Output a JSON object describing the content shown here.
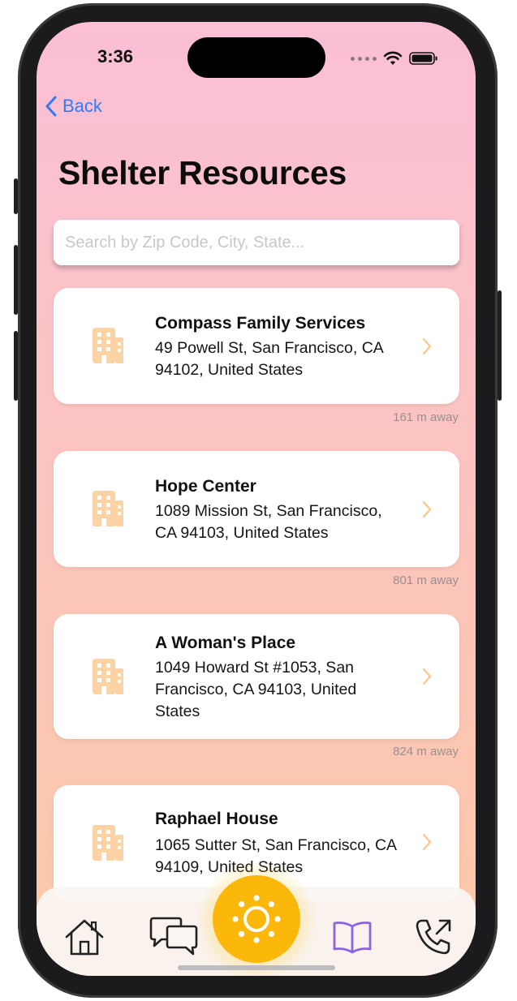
{
  "status_bar": {
    "time": "3:36"
  },
  "nav": {
    "back_label": "Back"
  },
  "page": {
    "title": "Shelter Resources"
  },
  "search": {
    "placeholder": "Search by Zip Code, City, State...",
    "value": ""
  },
  "shelters": [
    {
      "name": "Compass Family Services",
      "address": "49 Powell St, San Francisco, CA 94102, United States",
      "distance": "161 m away"
    },
    {
      "name": "Hope Center",
      "address": "1089 Mission St, San Francisco, CA 94103, United States",
      "distance": "801 m away"
    },
    {
      "name": "A Woman's Place",
      "address": "1049 Howard St #1053, San Francisco, CA 94103, United States",
      "distance": "824 m away"
    },
    {
      "name": "Raphael House",
      "address": "1065 Sutter St, San Francisco, CA 94109, United States",
      "distance": ""
    }
  ],
  "tabs": [
    {
      "icon": "home-icon"
    },
    {
      "icon": "chat-bubbles-icon"
    },
    {
      "icon": "sun-icon"
    },
    {
      "icon": "book-icon"
    },
    {
      "icon": "phone-outgoing-icon"
    }
  ],
  "colors": {
    "accent_blue": "#2f7cf6",
    "building_icon": "#fbd3a4",
    "chevron": "#fbc88e",
    "fab": "#fbb70a",
    "active_tab": "#8a63e6",
    "gradient_top": "#fbbfd6",
    "gradient_bottom": "#fcc9a8"
  }
}
